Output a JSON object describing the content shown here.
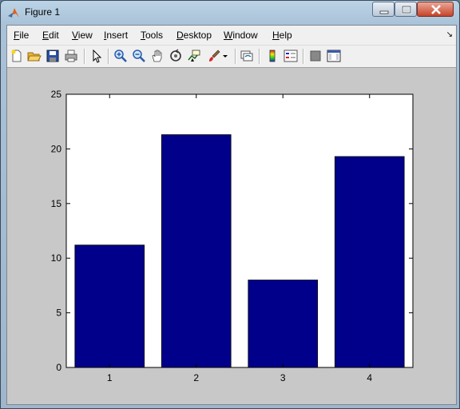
{
  "window": {
    "title": "Figure 1",
    "minimize_icon": "minimize-icon",
    "maximize_icon": "maximize-icon",
    "close_icon": "close-icon"
  },
  "menubar": {
    "items": [
      {
        "label": "File",
        "mnemonic": "F",
        "rest": "ile"
      },
      {
        "label": "Edit",
        "mnemonic": "E",
        "rest": "dit"
      },
      {
        "label": "View",
        "mnemonic": "V",
        "rest": "iew"
      },
      {
        "label": "Insert",
        "mnemonic": "I",
        "rest": "nsert"
      },
      {
        "label": "Tools",
        "mnemonic": "T",
        "rest": "ools"
      },
      {
        "label": "Desktop",
        "mnemonic": "D",
        "rest": "esktop"
      },
      {
        "label": "Window",
        "mnemonic": "W",
        "rest": "indow"
      },
      {
        "label": "Help",
        "mnemonic": "H",
        "rest": "elp"
      }
    ]
  },
  "toolbar": {
    "buttons": [
      "new-figure-icon",
      "open-file-icon",
      "save-icon",
      "print-icon",
      "edit-plot-arrow-icon",
      "zoom-in-icon",
      "zoom-out-icon",
      "pan-hand-icon",
      "rotate-3d-icon",
      "data-cursor-icon",
      "brush-icon",
      "link-plot-icon",
      "colorbar-icon",
      "legend-icon",
      "hide-plot-tools-icon",
      "show-plot-tools-icon"
    ]
  },
  "colors": {
    "bar_fill": "#00008b",
    "figure_bg": "#c8c8c8",
    "axes_bg": "#ffffff"
  },
  "chart_data": {
    "type": "bar",
    "categories": [
      "1",
      "2",
      "3",
      "4"
    ],
    "values": [
      11.2,
      21.3,
      8.0,
      19.3
    ],
    "xlabel": "",
    "ylabel": "",
    "ylim": [
      0,
      25
    ],
    "yticks": [
      0,
      5,
      10,
      15,
      20,
      25
    ],
    "grid": false,
    "legend": "none"
  }
}
